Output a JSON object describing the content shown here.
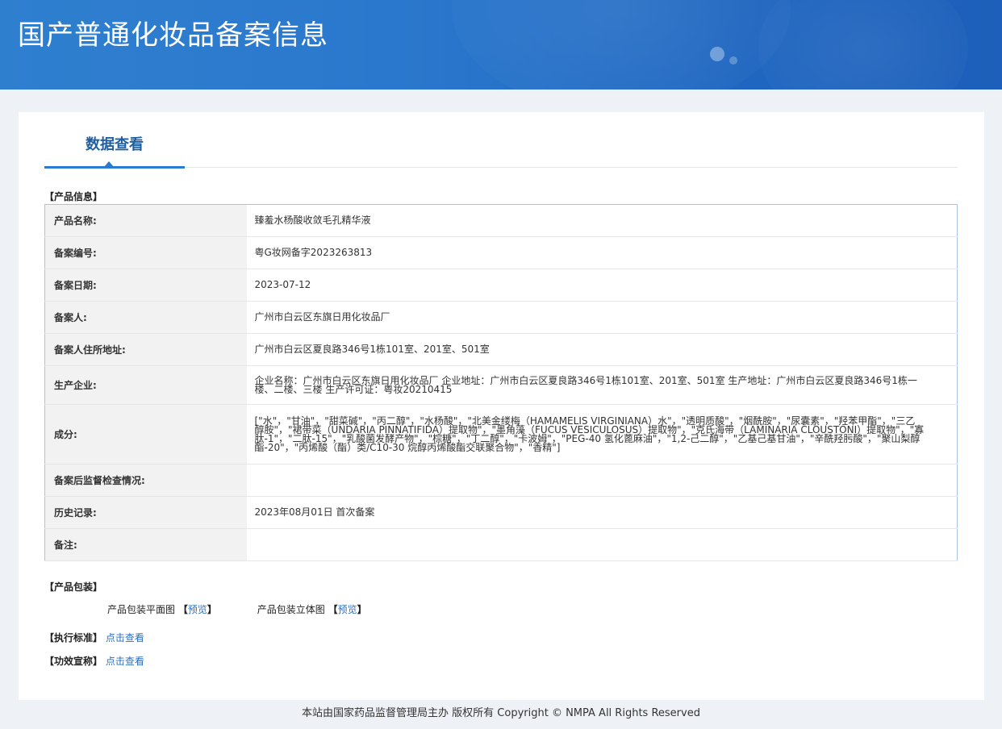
{
  "header": {
    "title": "国产普通化妆品备案信息"
  },
  "tab": {
    "label": "数据查看"
  },
  "product_info": {
    "section_title": "【产品信息】",
    "rows": [
      {
        "key": "产品名称:",
        "value": "臻羞水杨酸收敛毛孔精华液"
      },
      {
        "key": "备案编号:",
        "value": "粤G妆网备字2023263813"
      },
      {
        "key": "备案日期:",
        "value": "2023-07-12"
      },
      {
        "key": "备案人:",
        "value": "广州市白云区东旗日用化妆品厂"
      },
      {
        "key": "备案人住所地址:",
        "value": "广州市白云区夏良路346号1栋101室、201室、501室"
      },
      {
        "key": "生产企业:",
        "value": "企业名称：广州市白云区东旗日用化妆品厂 企业地址：广州市白云区夏良路346号1栋101室、201室、501室 生产地址：广州市白云区夏良路346号1栋一楼、二楼、三楼 生产许可证：粤妆20210415"
      },
      {
        "key": "成分:",
        "value": "[\"水\"，\"甘油\"，\"甜菜碱\"，\"丙二醇\"，\"水杨酸\"，\"北美金缕梅（HAMAMELIS VIRGINIANA）水\"，\"透明质酸\"，\"烟酰胺\"，\"尿囊素\"，\"羟苯甲酯\"，\"三乙醇胺\"，\"裙带菜（UNDARIA PINNATIFIDA）提取物\"，\"墨角藻（FUCUS VESICULOSUS）提取物\"，\"克氏海带（LAMINARIA CLOUSTONI）提取物\"，\"寡肽-1\"，\"二肽-15\"，\"乳酸菌发酵产物\"，\"棕糖\"，\"丁二醇\"，\"卡波姆\"，\"PEG-40 氢化蓖麻油\"，\"1,2-己二醇\"，\"乙基己基甘油\"，\"辛酰羟肟酸\"，\"聚山梨醇酯-20\"，\"丙烯酸（酯）类/C10-30 烷醇丙烯酸酯交联聚合物\"，\"香精\"]"
      },
      {
        "key": "备案后监督检查情况:",
        "value": ""
      },
      {
        "key": "历史记录:",
        "value": "2023年08月01日 首次备案"
      },
      {
        "key": "备注:",
        "value": ""
      }
    ]
  },
  "packaging": {
    "section_title": "【产品包装】",
    "flat_label": "产品包装平面图",
    "flat_link": "预览",
    "stereo_label": "产品包装立体图",
    "stereo_link": "预览",
    "bracket_open": "【",
    "bracket_close": "】"
  },
  "standard": {
    "label": "【执行标准】",
    "link": "点击查看"
  },
  "efficacy": {
    "label": "【功效宣称】",
    "link": "点击查看"
  },
  "footer": {
    "text": "本站由国家药品监督管理局主办 版权所有 Copyright © NMPA All Rights Reserved"
  },
  "colors": {
    "header_bg": "#2a78cd",
    "link": "#2a6fc0",
    "tab_accent": "#2a7bd0"
  }
}
